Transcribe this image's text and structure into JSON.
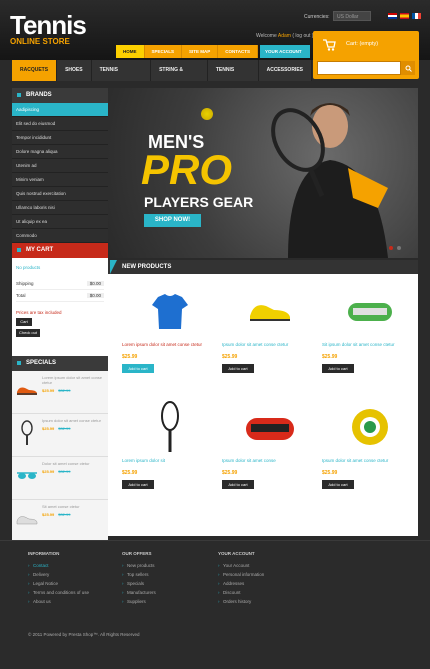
{
  "header": {
    "logo_main": "Tennis",
    "logo_sub": "ONLINE STORE",
    "currencies_label": "Currencies:",
    "currency_value": "US Dollar",
    "welcome_prefix": "Welcome",
    "welcome_user": "Adam",
    "welcome_logout": "( log out )",
    "top_nav": [
      "HOME",
      "SPECIALS",
      "SITE MAP",
      "CONTACTS"
    ],
    "my_account": "YOUR ACCOUNT",
    "cart_text": "Cart: (empty)",
    "search_placeholder": ""
  },
  "cat_nav": [
    "RACQUETS",
    "SHOES",
    "TENNIS APPAREL",
    "STRING & MORE",
    "TENNIS BAGS",
    "ACCESSORIES"
  ],
  "brands": {
    "title": "BRANDS",
    "items": [
      "Aadipiscing",
      "Elit sed do eiusmod",
      "Tempor incididunt",
      "Dolore magna aliqua",
      "Utenim ad",
      "Minim veniam",
      "Quis nostrud exercitation",
      "Ullamco laboris nisi",
      "Ut aliquip ex ea",
      "Commodo"
    ]
  },
  "my_cart": {
    "title": "MY CART",
    "no_products": "No products",
    "shipping_label": "Shipping",
    "shipping_value": "$0.00",
    "total_label": "Total",
    "total_value": "$0.00",
    "warn": "Prices are tax included",
    "cart_btn": "Cart",
    "checkout_btn": "Check out"
  },
  "specials": {
    "title": "SPECIALS",
    "items": [
      {
        "name": "Lorem ipsum dolor sit amet conse ctetur",
        "price": "$25.99",
        "old": "$32.99"
      },
      {
        "name": "Ipsum dolor sit amet conse ctetur",
        "price": "$25.99",
        "old": "$32.99"
      },
      {
        "name": "Dolor sit amet conse ctetur",
        "price": "$25.99",
        "old": "$32.99"
      },
      {
        "name": "Sit amet conse ctetur",
        "price": "$25.99",
        "old": "$32.99"
      }
    ]
  },
  "banner": {
    "line1": "MEN'S",
    "line2": "PRO",
    "line3": "PLAYERS GEAR",
    "button": "SHOP NOW!"
  },
  "new_products": {
    "title": "NEW PRODUCTS",
    "add_label": "Add to cart",
    "items": [
      {
        "name": "Lorem ipsum dolor sit amet conse ctetur",
        "price": "$25.99"
      },
      {
        "name": "Ipsum dolor sit amet conse ctetur",
        "price": "$25.99"
      },
      {
        "name": "Sit ipsum dolor sit amet conse ctetur",
        "price": "$25.99"
      },
      {
        "name": "Lorem ipsum dolor sit",
        "price": "$25.99"
      },
      {
        "name": "Ipsum dolor sit amet conse",
        "price": "$25.99"
      },
      {
        "name": "Ipsum dolor sit amet conse ctetur",
        "price": "$25.99"
      }
    ]
  },
  "footer": {
    "col1_title": "INFORMATION",
    "col1": [
      "Contact",
      "Delivery",
      "Legal Notice",
      "Terms and conditions of use",
      "About us"
    ],
    "col2_title": "OUR OFFERS",
    "col2": [
      "New products",
      "Top sellers",
      "Specials",
      "Manufacturers",
      "Suppliers"
    ],
    "col3_title": "YOUR ACCOUNT",
    "col3": [
      "Your Account",
      "Personal information",
      "Addresses",
      "Discount",
      "Orders history"
    ],
    "copyright": "© 2011 Powered by Presta Shop™. All Rights Reserved"
  },
  "colors": {
    "accent": "#f5a200",
    "teal": "#2ab5c8",
    "red": "#c62a1a"
  }
}
